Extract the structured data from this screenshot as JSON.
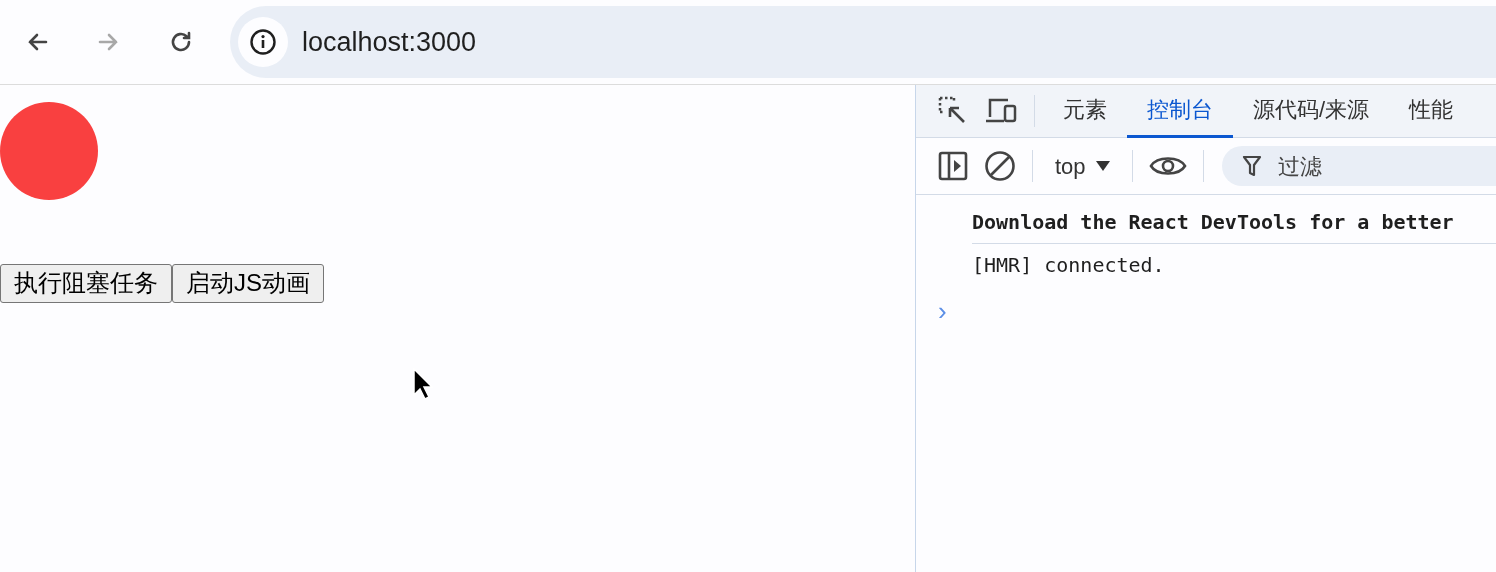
{
  "browser": {
    "nav_buttons": [
      {
        "kind": "back",
        "disabled": false
      },
      {
        "kind": "forward",
        "disabled": true
      },
      {
        "kind": "reload",
        "disabled": false
      }
    ],
    "address": "localhost:3000"
  },
  "page": {
    "buttons": [
      "执行阻塞任务",
      "启动JS动画"
    ]
  },
  "devtools": {
    "tabs": [
      {
        "label": "元素",
        "selected": false
      },
      {
        "label": "控制台",
        "selected": true
      },
      {
        "label": "源代码/来源",
        "selected": false
      },
      {
        "label": "性能",
        "selected": false
      }
    ],
    "context": "top",
    "filter": {
      "placeholder": "过滤"
    },
    "messages": [
      {
        "text": "Download the React DevTools for a better",
        "emphasis": true
      },
      {
        "text": "[HMR] connected.",
        "emphasis": false
      }
    ],
    "prompt": "›"
  }
}
